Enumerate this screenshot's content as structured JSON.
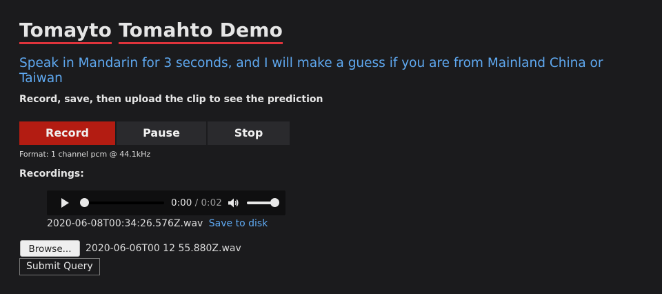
{
  "header": {
    "title_word1": "Tomayto",
    "title_word2": "Tomahto",
    "title_word3": "Demo",
    "subtitle": "Speak in Mandarin for 3 seconds, and I will make a guess if you are from Mainland China or Taiwan",
    "instructions": "Record, save, then upload the clip to see the prediction"
  },
  "controls": {
    "record_label": "Record",
    "pause_label": "Pause",
    "stop_label": "Stop",
    "format_text": "Format: 1 channel pcm @ 44.1kHz"
  },
  "recordings": {
    "label": "Recordings:",
    "player": {
      "current_time": "0:00",
      "separator": " / ",
      "duration": "0:02",
      "progress": 0.0,
      "volume": 1.0,
      "play_icon": "play-icon",
      "volume_icon": "volume-icon"
    },
    "filename": "2020-06-08T00:34:26.576Z.wav",
    "save_link": "Save to disk"
  },
  "upload": {
    "browse_label": "Browse...",
    "chosen_file": "2020-06-06T00 12 55.880Z.wav",
    "submit_label": "Submit Query"
  },
  "colors": {
    "background": "#1b1b1d",
    "record_button": "#b31c12",
    "link": "#5fa9f1",
    "title_underline": "#e0343c"
  }
}
